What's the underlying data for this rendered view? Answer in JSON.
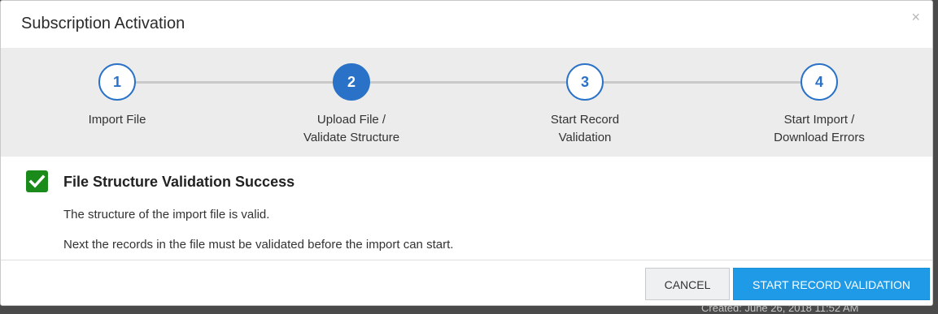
{
  "modal": {
    "title": "Subscription Activation",
    "close_glyph": "×"
  },
  "wizard": {
    "steps": [
      {
        "number": "1",
        "line1": "Import File",
        "line2": "",
        "state": "completed"
      },
      {
        "number": "2",
        "line1": "Upload File /",
        "line2": "Validate Structure",
        "state": "active"
      },
      {
        "number": "3",
        "line1": "Start Record",
        "line2": "Validation",
        "state": "pending"
      },
      {
        "number": "4",
        "line1": "Start Import /",
        "line2": "Download Errors",
        "state": "pending"
      }
    ]
  },
  "result": {
    "icon": "check-icon",
    "title": "File Structure Validation Success",
    "message1": "The structure of the import file is valid.",
    "message2": "Next the records in the file must be validated before the import can start."
  },
  "footer": {
    "cancel_label": "CANCEL",
    "primary_label": "START RECORD VALIDATION"
  },
  "background": {
    "partial_text": "Created: June 26, 2018 11:52 AM"
  },
  "colors": {
    "accent": "#2a72c7",
    "success": "#1a8a1a",
    "primary_button": "#1f9ae6"
  }
}
